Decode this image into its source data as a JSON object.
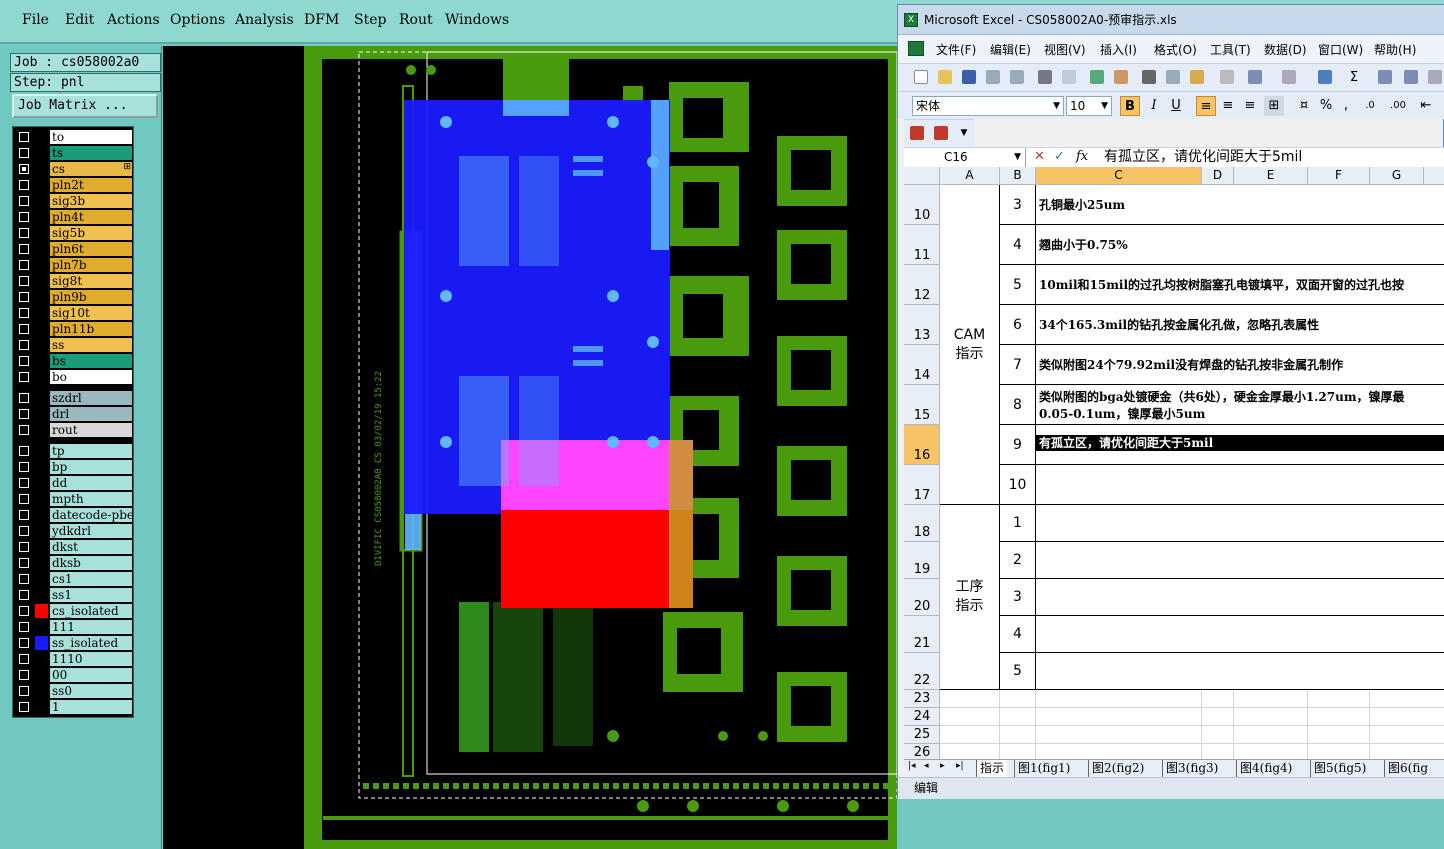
{
  "cam": {
    "menu": [
      "File",
      "Edit",
      "Actions",
      "Options",
      "Analysis",
      "DFM",
      "Step",
      "Rout",
      "Windows"
    ],
    "job_label": "Job : cs058002a0",
    "step_label": "Step: pnl",
    "job_matrix_label": "Job Matrix ...",
    "layers": [
      {
        "name": "to",
        "bg": "#ffffff",
        "swatch": "#000000",
        "checked": false
      },
      {
        "name": "ts",
        "bg": "#1a9c78",
        "swatch": "#000000",
        "checked": false
      },
      {
        "name": "cs",
        "bg": "#e8b84a",
        "swatch": "#000000",
        "checked": true,
        "expand": "⊞"
      },
      {
        "name": "pln2t",
        "bg": "#e0ac2c",
        "swatch": "#000000",
        "checked": false
      },
      {
        "name": "sig3b",
        "bg": "#f0c050",
        "swatch": "#000000",
        "checked": false
      },
      {
        "name": "pln4t",
        "bg": "#e0ac2c",
        "swatch": "#000000",
        "checked": false
      },
      {
        "name": "sig5b",
        "bg": "#f0c050",
        "swatch": "#000000",
        "checked": false
      },
      {
        "name": "pln6t",
        "bg": "#e0ac2c",
        "swatch": "#000000",
        "checked": false
      },
      {
        "name": "pln7b",
        "bg": "#e0ac2c",
        "swatch": "#000000",
        "checked": false
      },
      {
        "name": "sig8t",
        "bg": "#f0c050",
        "swatch": "#000000",
        "checked": false
      },
      {
        "name": "pln9b",
        "bg": "#e0ac2c",
        "swatch": "#000000",
        "checked": false
      },
      {
        "name": "sig10t",
        "bg": "#f0c050",
        "swatch": "#000000",
        "checked": false
      },
      {
        "name": "pln11b",
        "bg": "#e0ac2c",
        "swatch": "#000000",
        "checked": false
      },
      {
        "name": "ss",
        "bg": "#f0c050",
        "swatch": "#000000",
        "checked": false
      },
      {
        "name": "bs",
        "bg": "#1a9c78",
        "swatch": "#000000",
        "checked": false
      },
      {
        "name": "bo",
        "bg": "#ffffff",
        "swatch": "#000000",
        "checked": false
      },
      {
        "name": "szdrl",
        "bg": "#9ab8c0",
        "swatch": "#000000",
        "checked": false,
        "gap": true
      },
      {
        "name": "drl",
        "bg": "#9ab8c0",
        "swatch": "#000000",
        "checked": false
      },
      {
        "name": "rout",
        "bg": "#d8d8d8",
        "swatch": "#000000",
        "checked": false
      },
      {
        "name": "tp",
        "bg": "#a8e0dc",
        "swatch": "#000000",
        "checked": false,
        "gap": true
      },
      {
        "name": "bp",
        "bg": "#a8e0dc",
        "swatch": "#000000",
        "checked": false
      },
      {
        "name": "dd",
        "bg": "#a8e0dc",
        "swatch": "#000000",
        "checked": false
      },
      {
        "name": "mpth",
        "bg": "#a8e0dc",
        "swatch": "#000000",
        "checked": false
      },
      {
        "name": "datecode-pbe",
        "bg": "#a8e0dc",
        "swatch": "#000000",
        "checked": false
      },
      {
        "name": "ydkdrl",
        "bg": "#a8e0dc",
        "swatch": "#000000",
        "checked": false
      },
      {
        "name": "dkst",
        "bg": "#a8e0dc",
        "swatch": "#000000",
        "checked": false
      },
      {
        "name": "dksb",
        "bg": "#a8e0dc",
        "swatch": "#000000",
        "checked": false
      },
      {
        "name": "cs1",
        "bg": "#a8e0dc",
        "swatch": "#000000",
        "checked": false
      },
      {
        "name": "ss1",
        "bg": "#a8e0dc",
        "swatch": "#000000",
        "checked": false
      },
      {
        "name": "cs_isolated",
        "bg": "#a8e0dc",
        "swatch": "#ff0000",
        "checked": false
      },
      {
        "name": "111",
        "bg": "#a8e0dc",
        "swatch": "#000000",
        "checked": false
      },
      {
        "name": "ss_isolated",
        "bg": "#a8e0dc",
        "swatch": "#1a1aff",
        "checked": false
      },
      {
        "name": "1110",
        "bg": "#a8e0dc",
        "swatch": "#000000",
        "checked": false
      },
      {
        "name": "00",
        "bg": "#a8e0dc",
        "swatch": "#000000",
        "checked": false
      },
      {
        "name": "ss0",
        "bg": "#a8e0dc",
        "swatch": "#000000",
        "checked": false
      },
      {
        "name": "1",
        "bg": "#a8e0dc",
        "swatch": "#000000",
        "checked": false
      }
    ],
    "colors": {
      "board_green": "#4a9a0e",
      "pad_green": "#2e8b1a",
      "blue_overlay": "#1a1aff",
      "red_overlay": "#ff0000",
      "magenta_overlay": "#ff44ff"
    }
  },
  "excel": {
    "title": "Microsoft Excel - CS058002A0-预审指示.xls",
    "menu": [
      "文件(F)",
      "编辑(E)",
      "视图(V)",
      "插入(I)",
      "格式(O)",
      "工具(T)",
      "数据(D)",
      "窗口(W)",
      "帮助(H)"
    ],
    "font_name": "宋体",
    "font_size": "10",
    "name_box": "C16",
    "formula": "有孤立区，请优化间距大于5mil",
    "columns": [
      "A",
      "B",
      "C",
      "D",
      "E",
      "F",
      "G"
    ],
    "rows": [
      {
        "num": "10",
        "b": "3",
        "c": "孔铜最小25um"
      },
      {
        "num": "11",
        "b": "4",
        "c": "翘曲小于0.75%"
      },
      {
        "num": "12",
        "b": "5",
        "c": "10mil和15mil的过孔均按树脂塞孔电镀填平，双面开窗的过孔也按"
      },
      {
        "num": "13",
        "b": "6",
        "c": "34个165.3mil的钻孔按金属化孔做，忽略孔表属性"
      },
      {
        "num": "14",
        "b": "7",
        "c": "类似附图24个79.92mil没有焊盘的钻孔按非金属孔制作"
      },
      {
        "num": "15",
        "b": "8",
        "c": "类似附图的bga处镀硬金（共6处），硬金金厚最小1.27um，镍厚最",
        "c2": "0.05-0.1um，镍厚最小5um"
      },
      {
        "num": "16",
        "b": "9",
        "c": "有孤立区，请优化间距大于5mil"
      },
      {
        "num": "17",
        "b": "10",
        "c": ""
      },
      {
        "num": "18",
        "b": "1",
        "c": ""
      },
      {
        "num": "19",
        "b": "2",
        "c": ""
      },
      {
        "num": "20",
        "b": "3",
        "c": ""
      },
      {
        "num": "21",
        "b": "4",
        "c": ""
      },
      {
        "num": "22",
        "b": "5",
        "c": ""
      },
      {
        "num": "23"
      },
      {
        "num": "24"
      },
      {
        "num": "25"
      },
      {
        "num": "26"
      }
    ],
    "group_cam": [
      "CAM",
      "指示"
    ],
    "group_process": [
      "工序",
      "指示"
    ],
    "sheet_nav": [
      "|◂",
      "◂",
      "▸",
      "▸|"
    ],
    "sheet_tabs": [
      "指示",
      "图1(fig1)",
      "图2(fig2)",
      "图3(fig3)",
      "图4(fig4)",
      "图5(fig5)",
      "图6(fig"
    ],
    "status": "编辑"
  }
}
